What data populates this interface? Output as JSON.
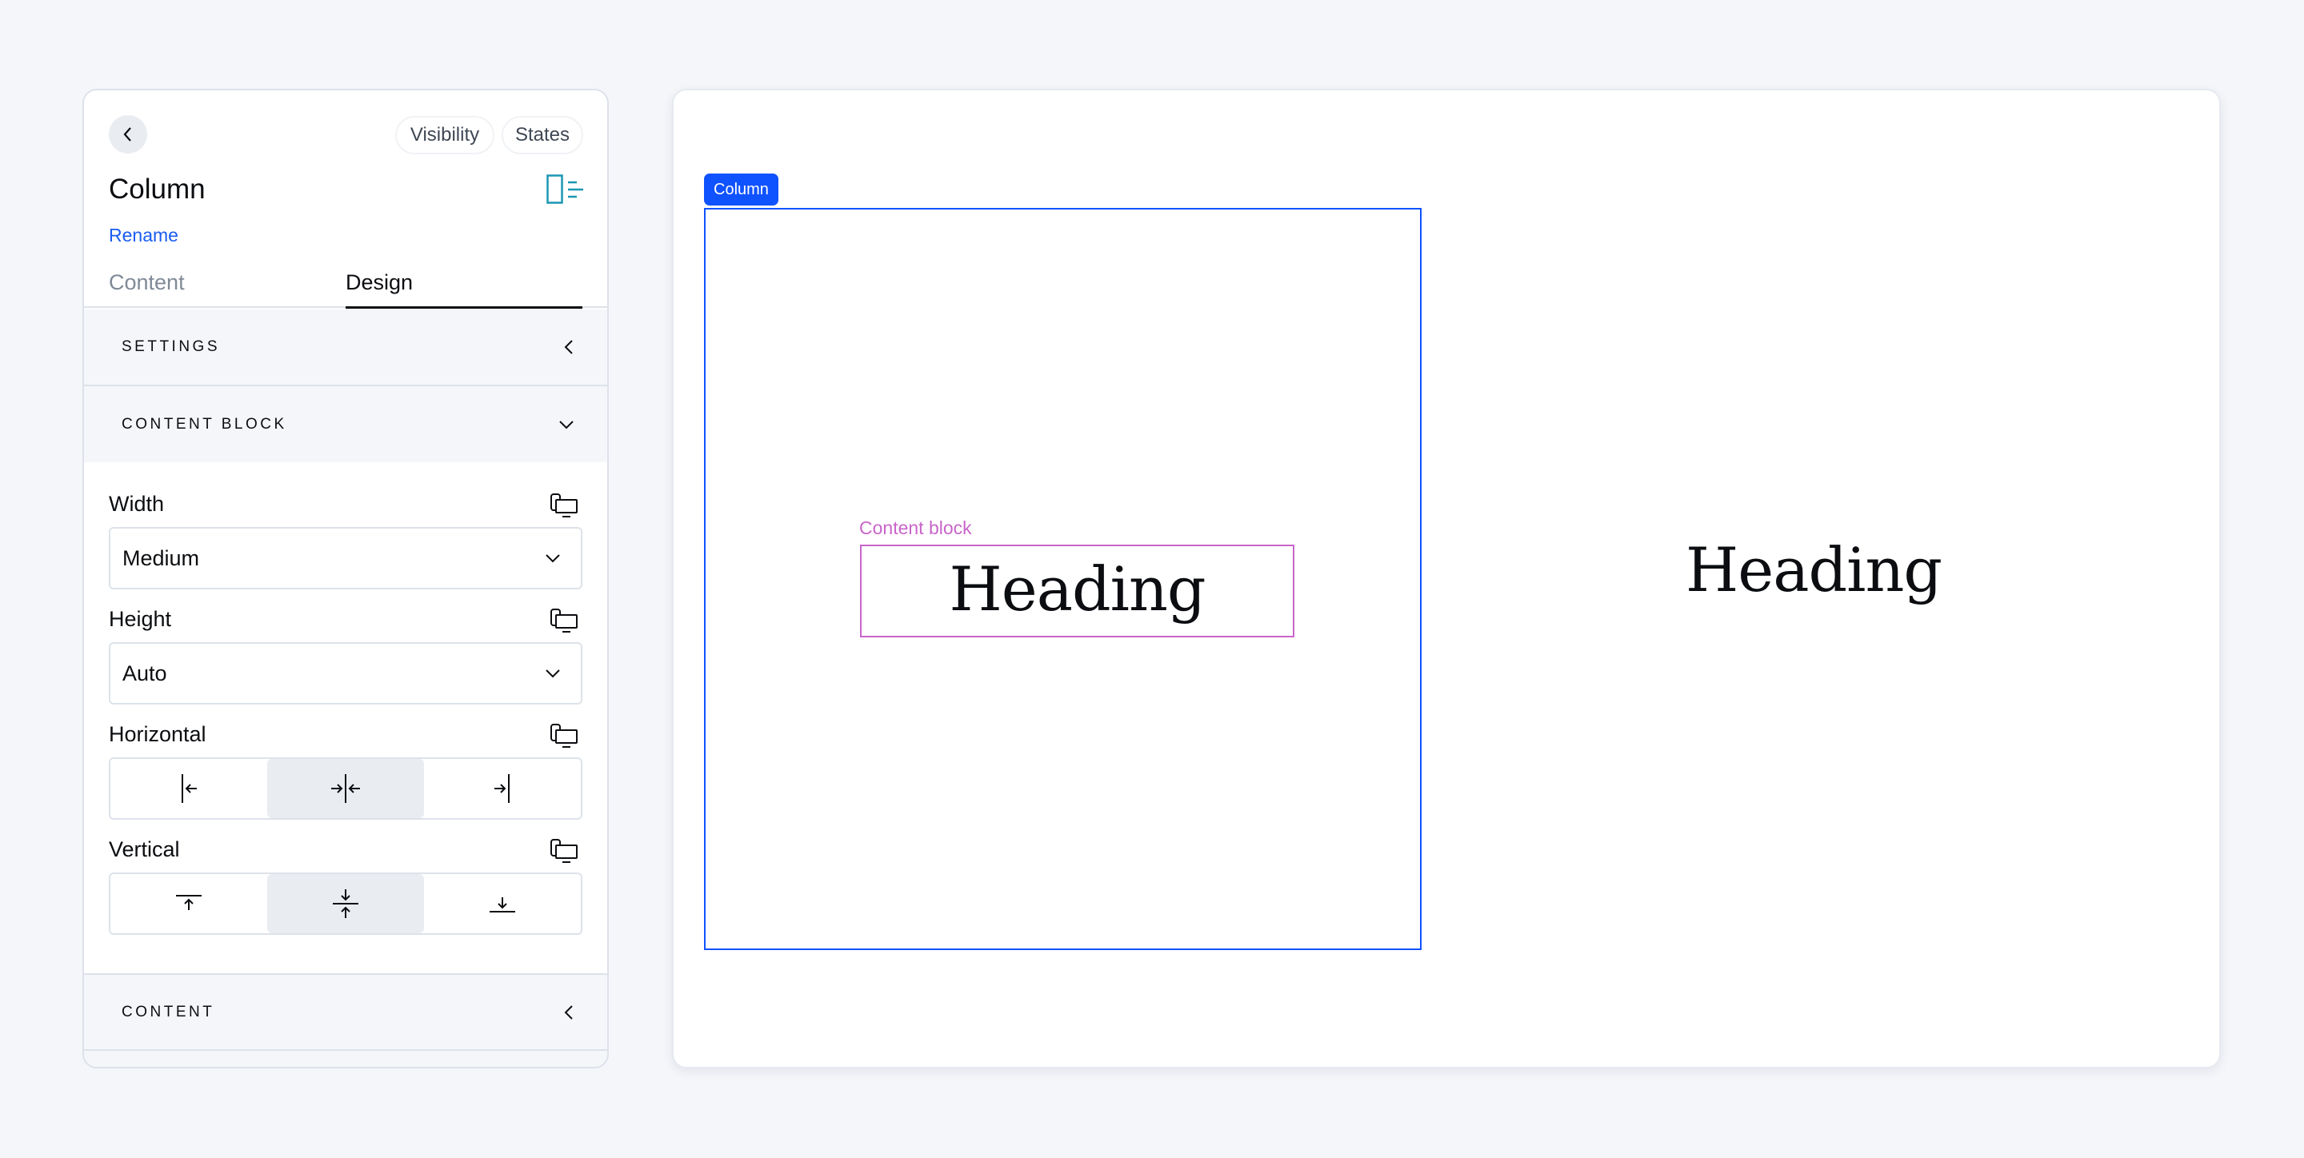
{
  "panel": {
    "back_icon": "chevron-left-icon",
    "pills": {
      "visibility": "Visibility",
      "states": "States"
    },
    "title": "Column",
    "layout_icon": "column-layout-icon",
    "rename": "Rename",
    "tabs": [
      {
        "label": "Content",
        "active": false
      },
      {
        "label": "Design",
        "active": true
      }
    ],
    "sections": {
      "settings": {
        "label": "SETTINGS",
        "state": "collapsed"
      },
      "content_block": {
        "label": "CONTENT BLOCK",
        "state": "expanded"
      },
      "content": {
        "label": "CONTENT",
        "state": "collapsed"
      }
    },
    "fields": {
      "width": {
        "label": "Width",
        "value": "Medium"
      },
      "height": {
        "label": "Height",
        "value": "Auto"
      },
      "horizontal": {
        "label": "Horizontal",
        "options": [
          "left",
          "center",
          "right"
        ],
        "selected": "center"
      },
      "vertical": {
        "label": "Vertical",
        "options": [
          "top",
          "middle",
          "bottom"
        ],
        "selected": "middle"
      }
    }
  },
  "canvas": {
    "column_tag": "Column",
    "content_block_label": "Content block",
    "heading_selected": "Heading",
    "heading_preview": "Heading"
  },
  "colors": {
    "accent_blue": "#0f52ff",
    "content_block_magenta": "#c965c9",
    "link_blue": "#1a5cf0",
    "layout_icon_teal": "#1c96b4"
  }
}
